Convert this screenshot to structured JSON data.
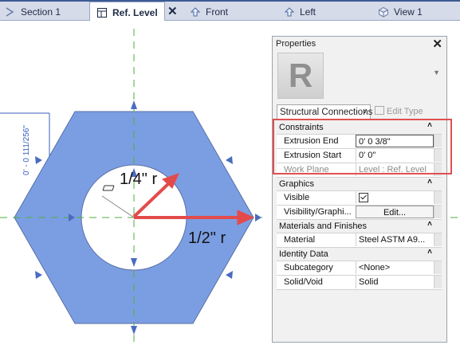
{
  "tabs": [
    {
      "label": "Section 1",
      "icon": "section-icon"
    },
    {
      "label": "Ref. Level",
      "icon": "floor-plan-icon",
      "active": true
    },
    {
      "label": "Front",
      "icon": "elevation-icon"
    },
    {
      "label": "Left",
      "icon": "elevation-icon"
    },
    {
      "label": "View 1",
      "icon": "3d-view-icon"
    }
  ],
  "canvas": {
    "annotations": {
      "inner_radius": "1/4\" r",
      "outer_radius": "1/2\" r",
      "dimension": "0' - 0 111/256\""
    },
    "colors": {
      "hexagon": "#7b9ee3",
      "arrow": "#e34b4b",
      "reference_line": "#4fae3f",
      "dim": "#3a5fbf"
    }
  },
  "properties": {
    "title": "Properties",
    "close": "✕",
    "thumb_letter": "R",
    "type_selector": "Structural Connections",
    "edit_type": "Edit Type",
    "sections": [
      {
        "name": "Constraints",
        "rows": [
          {
            "key": "Extrusion End",
            "value": "0'  0 3/8\""
          },
          {
            "key": "Extrusion Start",
            "value": "0'  0\""
          },
          {
            "key": "Work Plane",
            "value": "Level : Ref. Level"
          }
        ]
      },
      {
        "name": "Graphics",
        "rows": [
          {
            "key": "Visible",
            "value": ""
          },
          {
            "key": "Visibility/Graphi...",
            "value": "Edit..."
          }
        ]
      },
      {
        "name": "Materials and Finishes",
        "rows": [
          {
            "key": "Material",
            "value": "Steel ASTM A9..."
          }
        ]
      },
      {
        "name": "Identity Data",
        "rows": [
          {
            "key": "Subcategory",
            "value": "<None>"
          },
          {
            "key": "Solid/Void",
            "value": "Solid"
          }
        ]
      }
    ]
  }
}
